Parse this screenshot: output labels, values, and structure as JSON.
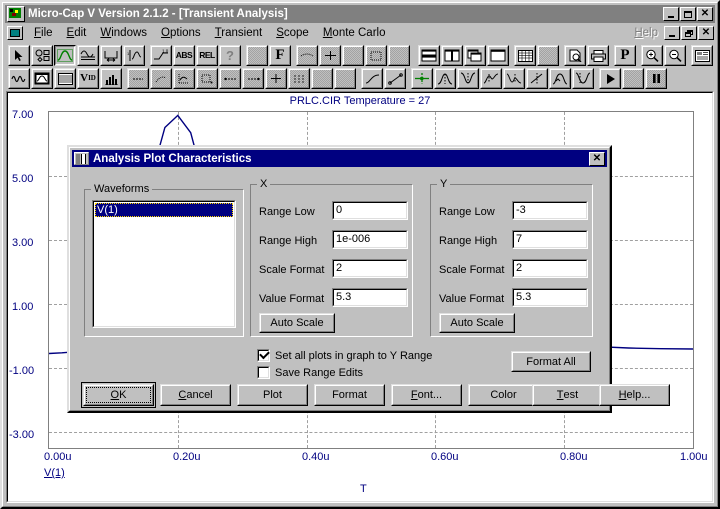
{
  "window": {
    "title": "Micro-Cap V Version 2.1.2 - [Transient Analysis]",
    "icon": "microcap-app-icon",
    "buttons": {
      "minimize": "_",
      "maximize": "□",
      "close": "✕"
    },
    "mdi_buttons": {
      "minimize": "_",
      "restore": "❐",
      "close": "✕"
    }
  },
  "menu": {
    "doc_icon": "document-control-icon",
    "items": [
      {
        "label": "File",
        "mnemonic": "F"
      },
      {
        "label": "Edit",
        "mnemonic": "E"
      },
      {
        "label": "Windows",
        "mnemonic": "W"
      },
      {
        "label": "Options",
        "mnemonic": "O"
      },
      {
        "label": "Transient",
        "mnemonic": "T"
      },
      {
        "label": "Scope",
        "mnemonic": "S"
      },
      {
        "label": "Monte Carlo",
        "mnemonic": "M"
      }
    ],
    "help": {
      "label": "Help",
      "mnemonic": "H"
    }
  },
  "toolbar_row1": [
    {
      "name": "select-arrow-tool",
      "icon": "arrow",
      "pressed": false
    },
    {
      "name": "component-shapes-tool",
      "icon": "shapes",
      "pressed": false
    },
    {
      "name": "waveform-plot-tool",
      "icon": "green-curve",
      "pressed": true
    },
    {
      "name": "scale-tool",
      "icon": "scale-graph",
      "pressed": false
    },
    {
      "name": "measure-tool",
      "icon": "measure",
      "pressed": false
    },
    {
      "name": "peak-tool",
      "icon": "peak",
      "pressed": false
    },
    {
      "name": "step-tool",
      "icon": "step",
      "pressed": false
    },
    {
      "name": "abs-button",
      "icon": "text",
      "text": "ABS",
      "pressed": false
    },
    {
      "name": "rel-button",
      "icon": "text",
      "text": "REL",
      "pressed": false
    },
    {
      "name": "help-question-tool",
      "icon": "question",
      "pressed": false
    },
    {
      "name": "dither-tool-1",
      "icon": "dither",
      "pressed": false
    },
    {
      "name": "formula-f-tool",
      "icon": "text",
      "text": "F",
      "pressed": false
    },
    {
      "name": "dither-tool-2",
      "icon": "dither",
      "pressed": false
    },
    {
      "name": "dither-tool-3",
      "icon": "dither",
      "pressed": false
    },
    {
      "name": "dither-tool-4",
      "icon": "dither",
      "pressed": false
    },
    {
      "name": "dither-tool-5",
      "icon": "dither",
      "pressed": false
    },
    {
      "name": "dither-tool-6",
      "icon": "dither",
      "pressed": false
    },
    {
      "name": "tile-horizontal-button",
      "icon": "tile-h",
      "pressed": false
    },
    {
      "name": "tile-vertical-button",
      "icon": "tile-v",
      "pressed": false
    },
    {
      "name": "cascade-button",
      "icon": "cascade",
      "pressed": false
    },
    {
      "name": "maximize-window-button",
      "icon": "blank-window",
      "pressed": false
    },
    {
      "name": "grid-button",
      "icon": "grid",
      "pressed": false
    },
    {
      "name": "dither-tool-7",
      "icon": "dither",
      "pressed": false
    },
    {
      "name": "print-preview-button",
      "icon": "preview",
      "pressed": false
    },
    {
      "name": "print-button",
      "icon": "printer",
      "pressed": false
    },
    {
      "name": "page-p-button",
      "icon": "text",
      "text": "P",
      "pressed": false
    },
    {
      "name": "zoom-in-button",
      "icon": "zoom-in",
      "pressed": false
    },
    {
      "name": "zoom-out-button",
      "icon": "zoom-out",
      "pressed": false
    },
    {
      "name": "properties-button",
      "icon": "properties",
      "pressed": false
    }
  ],
  "toolbar_row2": [
    {
      "name": "waveform-sine-tool",
      "icon": "sine",
      "pressed": false
    },
    {
      "name": "analysis-window-tool",
      "icon": "analysis-window",
      "pressed": false
    },
    {
      "name": "numeric-output-tool",
      "icon": "table",
      "pressed": false
    },
    {
      "name": "vid-tool",
      "icon": "text",
      "text": "VID",
      "pressed": false
    },
    {
      "name": "histogram-tool",
      "icon": "histogram",
      "pressed": false
    },
    {
      "name": "dither-tool-8",
      "icon": "dither",
      "pressed": false
    },
    {
      "name": "dither-tool-9",
      "icon": "dither",
      "pressed": false
    },
    {
      "name": "dither-tool-10",
      "icon": "dither",
      "pressed": false
    },
    {
      "name": "dither-tool-11",
      "icon": "dither",
      "pressed": false
    },
    {
      "name": "dither-tool-12",
      "icon": "dither",
      "pressed": false
    },
    {
      "name": "dither-tool-13",
      "icon": "dither",
      "pressed": false
    },
    {
      "name": "dither-tool-14",
      "icon": "dither",
      "pressed": false
    },
    {
      "name": "dither-tool-15",
      "icon": "dither",
      "pressed": false
    },
    {
      "name": "dither-tool-16",
      "icon": "dither",
      "pressed": false
    },
    {
      "name": "dither-tool-17",
      "icon": "dither",
      "pressed": false
    },
    {
      "name": "linear-fit-tool",
      "icon": "line-up",
      "pressed": false
    },
    {
      "name": "scatter-fit-tool",
      "icon": "line-dots",
      "pressed": false
    },
    {
      "name": "cursor-cross-tool",
      "icon": "green-cross",
      "pressed": false
    },
    {
      "name": "peak-curve-tool",
      "icon": "curve-peak",
      "pressed": false
    },
    {
      "name": "valley-curve-tool",
      "icon": "curve-valley",
      "pressed": false
    },
    {
      "name": "high-curve-tool",
      "icon": "curve-high",
      "pressed": false
    },
    {
      "name": "low-curve-tool",
      "icon": "curve-low",
      "pressed": false
    },
    {
      "name": "inflection-tool",
      "icon": "curve-slope",
      "pressed": false
    },
    {
      "name": "global-high-tool",
      "icon": "curve-ghigh",
      "pressed": false
    },
    {
      "name": "global-low-tool",
      "icon": "curve-glow",
      "pressed": false
    },
    {
      "name": "run-button",
      "icon": "play",
      "pressed": false
    },
    {
      "name": "dither-tool-18",
      "icon": "dither",
      "pressed": false
    },
    {
      "name": "pause-button",
      "icon": "pause",
      "pressed": false
    }
  ],
  "plot": {
    "title": "PRLC.CIR Temperature = 27",
    "y_label": "V(1)",
    "x_label": "T"
  },
  "chart_data": {
    "type": "line",
    "title": "PRLC.CIR Temperature = 27",
    "xlabel": "T",
    "ylabel": "V(1)",
    "xlim": [
      0,
      1e-06
    ],
    "ylim": [
      -3,
      7
    ],
    "grid": true,
    "legend": "V(1)",
    "xticks": [
      "0.00u",
      "0.20u",
      "0.40u",
      "0.60u",
      "0.80u",
      "1.00u"
    ],
    "xtick_values": [
      0,
      2e-07,
      4e-07,
      6e-07,
      8e-07,
      1e-06
    ],
    "yticks": [
      "7.00",
      "5.00",
      "3.00",
      "1.00",
      "-1.00",
      "-3.00"
    ],
    "ytick_values": [
      7,
      5,
      3,
      1,
      -1,
      -3
    ],
    "series": [
      {
        "name": "V(1)",
        "color": "#000080",
        "x": [
          0,
          0.02,
          0.04,
          0.06,
          0.08,
          0.1,
          0.12,
          0.14,
          0.16,
          0.18,
          0.2,
          0.22,
          0.24,
          0.26,
          0.28,
          0.3,
          0.34,
          0.38,
          0.42,
          0.46,
          0.5,
          0.55,
          0.6,
          0.65,
          0.7,
          0.75,
          0.8,
          0.85,
          0.9,
          0.95,
          1.0
        ],
        "y": [
          0.0,
          0.02,
          0.05,
          0.1,
          0.22,
          0.55,
          1.4,
          3.1,
          5.2,
          6.55,
          6.9,
          6.4,
          5.0,
          3.1,
          1.3,
          0.3,
          -0.2,
          0.05,
          0.25,
          0.3,
          0.25,
          0.18,
          0.12,
          0.14,
          0.18,
          0.2,
          0.22,
          0.2,
          0.16,
          0.14,
          0.13
        ]
      }
    ]
  },
  "dialog": {
    "title": "Analysis Plot Characteristics",
    "icon": "plot-characteristics-icon",
    "close_label": "✕",
    "waveforms": {
      "group_label": "Waveforms",
      "items": [
        "V(1)"
      ],
      "selected": "V(1)"
    },
    "x_group": {
      "label": "X",
      "fields": [
        {
          "label": "Range Low",
          "value": "0"
        },
        {
          "label": "Range High",
          "value": "1e-006"
        },
        {
          "label": "Scale Format",
          "value": "2"
        },
        {
          "label": "Value Format",
          "value": "5.3"
        }
      ],
      "auto_scale": "Auto Scale"
    },
    "y_group": {
      "label": "Y",
      "fields": [
        {
          "label": "Range Low",
          "value": "-3"
        },
        {
          "label": "Range High",
          "value": "7"
        },
        {
          "label": "Scale Format",
          "value": "2"
        },
        {
          "label": "Value Format",
          "value": "5.3"
        }
      ],
      "auto_scale": "Auto Scale"
    },
    "checkboxes": [
      {
        "label": "Set all plots in graph to Y Range",
        "checked": true
      },
      {
        "label": "Save Range Edits",
        "checked": false
      }
    ],
    "format_all": "Format All",
    "buttons": [
      {
        "label": "OK",
        "mnemonic": "O",
        "default": true
      },
      {
        "label": "Cancel",
        "mnemonic": "C",
        "default": false
      },
      {
        "label": "Plot",
        "mnemonic": "",
        "default": false
      },
      {
        "label": "Format",
        "mnemonic": "",
        "default": false
      },
      {
        "label": "Font...",
        "mnemonic": "F",
        "default": false
      },
      {
        "label": "Color",
        "mnemonic": "",
        "default": false
      },
      {
        "label": "Test",
        "mnemonic": "T",
        "default": false
      },
      {
        "label": "Help...",
        "mnemonic": "H",
        "default": false
      }
    ]
  },
  "colors": {
    "face": "#c0c0c0",
    "title_active": "#000080",
    "title_inactive": "#808080",
    "plot_ink": "#000080",
    "accent_green": "#008000"
  }
}
